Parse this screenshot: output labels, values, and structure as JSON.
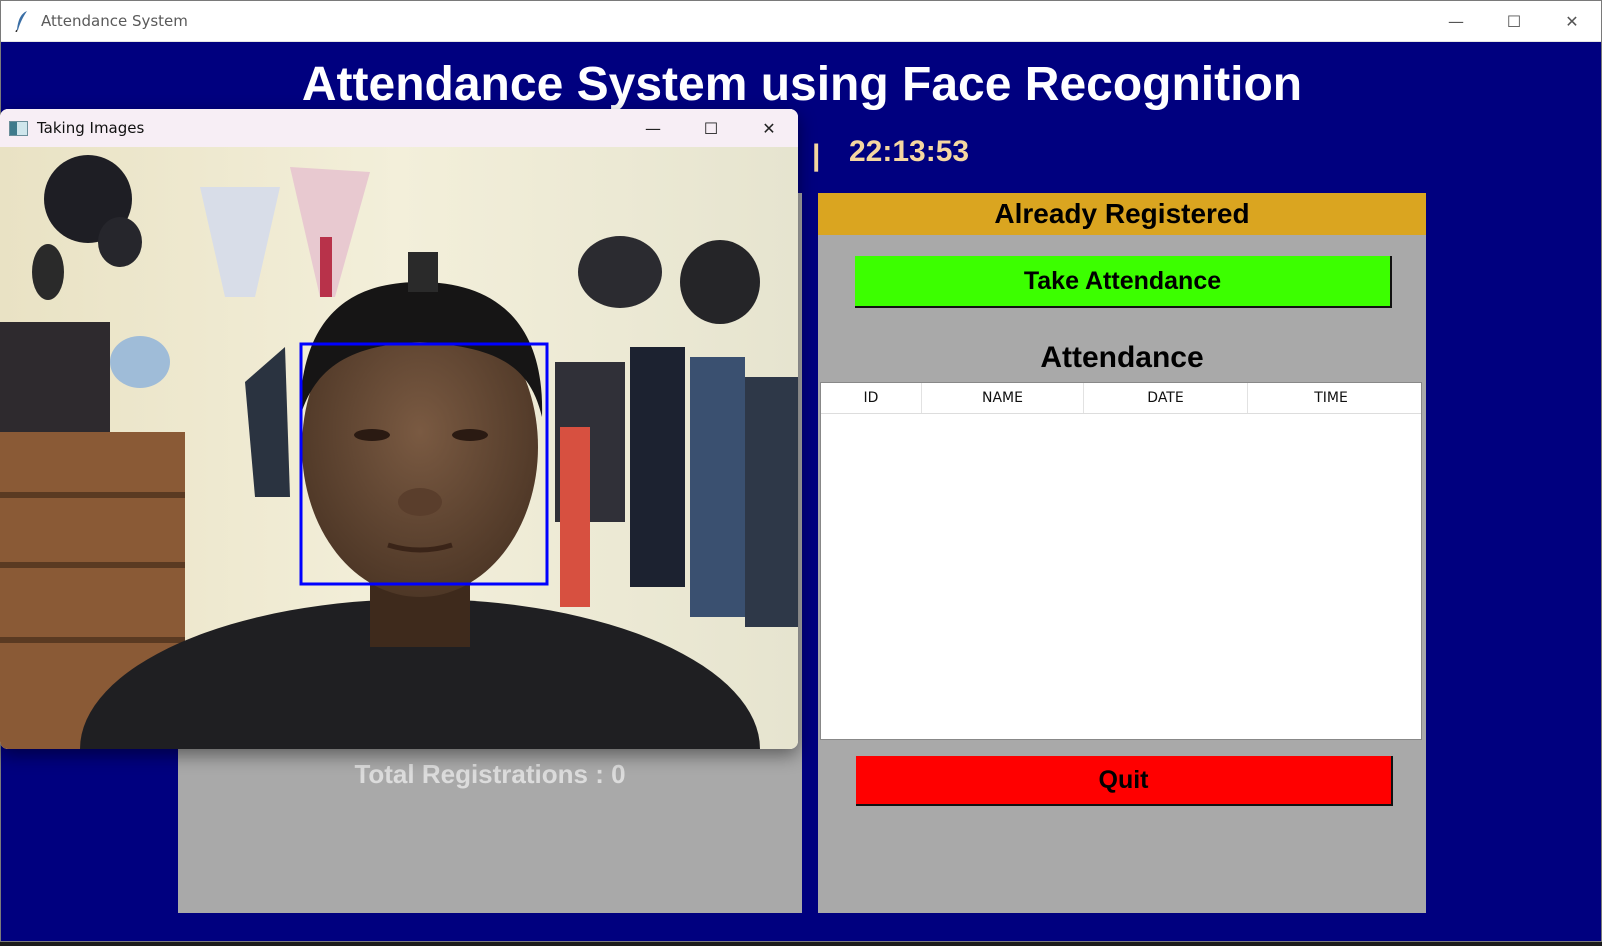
{
  "window": {
    "title": "Attendance System",
    "icon": "feather-icon",
    "controls": [
      "minimize-icon",
      "maximize-icon",
      "close-icon"
    ]
  },
  "header": {
    "title": "Attendance System using Face Recognition",
    "separator": "|",
    "time": "22:13:53"
  },
  "left_panel": {
    "total_registrations": "Total Registrations : 0"
  },
  "right_panel": {
    "header": "Already Registered",
    "take_attendance_label": "Take Attendance",
    "attendance_label": "Attendance",
    "table": {
      "columns": [
        "ID",
        "NAME",
        "DATE",
        "TIME"
      ],
      "rows": []
    },
    "quit_label": "Quit"
  },
  "camera_window": {
    "title": "Taking Images",
    "icon": "opencv-window-icon",
    "controls": [
      "minimize-icon",
      "maximize-icon",
      "close-icon"
    ],
    "face_box_color": "#0000ff"
  },
  "colors": {
    "background": "#00007f",
    "panel": "#a9a9a9",
    "header_gold": "#daa520",
    "take_button": "#3cff00",
    "quit_button": "#ff0000",
    "clock": "#f5d7a1"
  }
}
